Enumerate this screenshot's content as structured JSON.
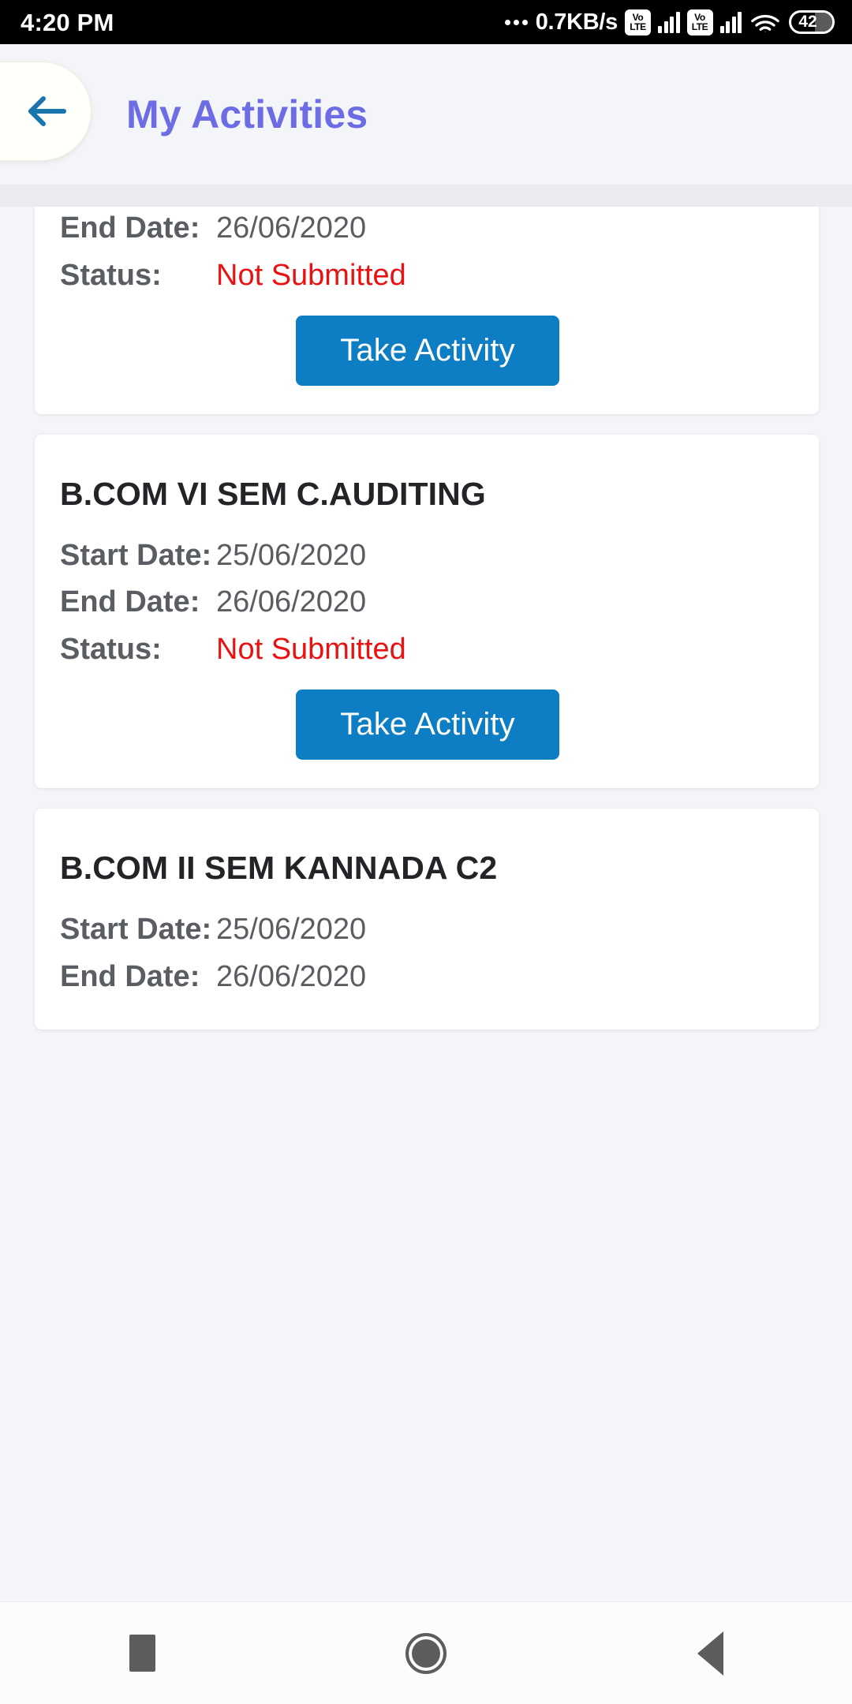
{
  "status_bar": {
    "time": "4:20 PM",
    "data_rate": "0.7KB/s",
    "volte_top": "Vo",
    "volte_bottom": "LTE",
    "battery_level": "42",
    "icons": [
      "ellipsis-icon",
      "volte-icon",
      "signal-bars-icon",
      "volte-icon",
      "signal-bars-icon",
      "wifi-icon",
      "battery-icon"
    ]
  },
  "header": {
    "back_icon": "arrow-left-icon",
    "title": "My Activities",
    "title_color": "#6c6ce4"
  },
  "theme": {
    "page_bg": "#f4f5f8",
    "card_bg": "#ffffff",
    "label_color": "#5a5d61",
    "value_color": "#5a5d61",
    "status_color": "#e81212",
    "button_color": "#0d7dc4",
    "button_text_color": "#ffffff"
  },
  "labels": {
    "start_date": "Start Date:",
    "end_date": "End Date:",
    "status": "Status:",
    "take_activity": "Take Activity"
  },
  "activities": [
    {
      "title": "",
      "clipped": true,
      "start_date": "",
      "end_date": "26/06/2020",
      "status": "Not Submitted",
      "button": "Take Activity"
    },
    {
      "title": "B.COM VI SEM C.AUDITING",
      "clipped": false,
      "start_date": "25/06/2020",
      "end_date": "26/06/2020",
      "status": "Not Submitted",
      "button": "Take Activity"
    },
    {
      "title": "B.COM II SEM KANNADA C2",
      "clipped": false,
      "start_date": "25/06/2020",
      "end_date": "26/06/2020",
      "status": "",
      "button": ""
    }
  ],
  "nav_bar": {
    "recents_icon": "square-icon",
    "home_icon": "circle-icon",
    "back_icon": "triangle-back-icon"
  }
}
